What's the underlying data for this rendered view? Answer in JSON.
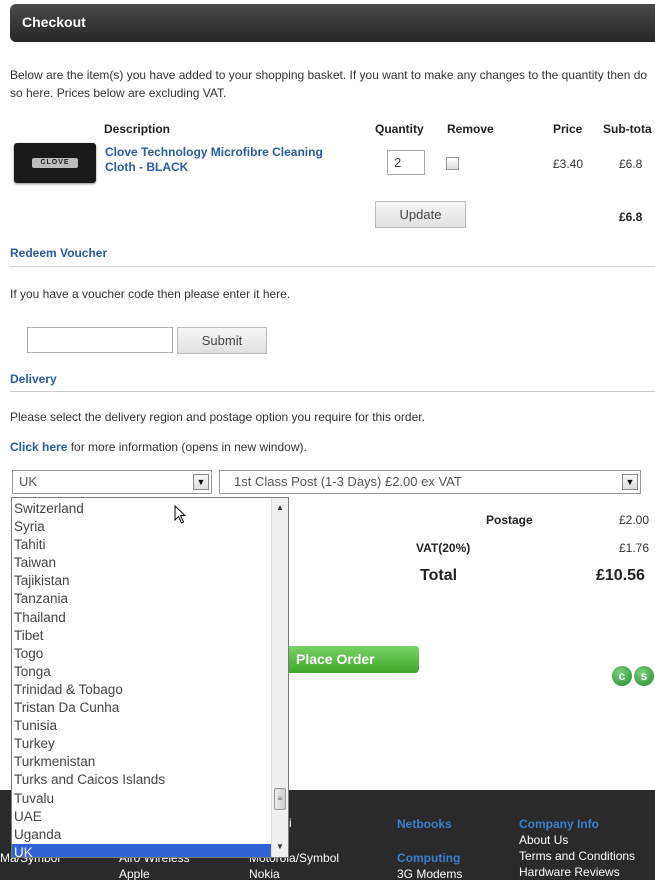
{
  "header": {
    "title": "Checkout"
  },
  "intro": "Below are the item(s) you have added to your shopping basket. If you want to make any changes to the quantity then do so here. Prices below are excluding VAT.",
  "basket": {
    "columns": {
      "description": "Description",
      "quantity": "Quantity",
      "remove": "Remove",
      "price": "Price",
      "subtotal": "Sub-tota"
    },
    "item": {
      "thumb_logo": "CLOVE",
      "name": "Clove Technology Microfibre Cleaning Cloth - BLACK",
      "quantity": "2",
      "price": "£3.40",
      "subtotal": "£6.8"
    },
    "update_label": "Update",
    "total": "£6.8"
  },
  "voucher": {
    "title": "Redeem Voucher",
    "text": "If you have a voucher code then please enter it here.",
    "input_value": "",
    "submit_label": "Submit"
  },
  "delivery": {
    "title": "Delivery",
    "text": "Please select the delivery region and postage option you require for this order.",
    "link_text": "Click here",
    "link_rest": " for more information (opens in new window).",
    "region_value": "UK",
    "postage_value": "1st Class Post (1-3 Days) £2.00 ex VAT"
  },
  "summary": {
    "postage_label": "Postage",
    "postage_value": "£2.00",
    "vat_label": "VAT(20%)",
    "vat_value": "£1.76",
    "total_label": "Total",
    "total_value": "£10.56",
    "pay_icon_1": "c",
    "pay_icon_2": "s",
    "place_order": "Place Order"
  },
  "dropdown_options": [
    "Switzerland",
    "Syria",
    "Tahiti",
    "Taiwan",
    "Tajikistan",
    "Tanzania",
    "Thailand",
    "Tibet",
    "Togo",
    "Tonga",
    "Trinidad & Tobago",
    "Tristan Da Cunha",
    "Tunisia",
    "Turkey",
    "Turkmenistan",
    "Turks and Caicos Islands",
    "Tuvalu",
    "UAE",
    "Uganda",
    "UK"
  ],
  "dropdown_selected": "UK",
  "footer": {
    "col1": [
      "Ma/Symbol"
    ],
    "col2": [
      "Airo Wireless",
      "Apple"
    ],
    "col3_top": "i",
    "col3": [
      "Motorola/Symbol",
      "Nokia"
    ],
    "col4_head1": "Netbooks",
    "col4_head2": "Computing",
    "col4_item": "3G Modems",
    "col5_head": "Company Info",
    "col5": [
      "About Us",
      "Terms and Conditions",
      "Hardware Reviews"
    ]
  }
}
